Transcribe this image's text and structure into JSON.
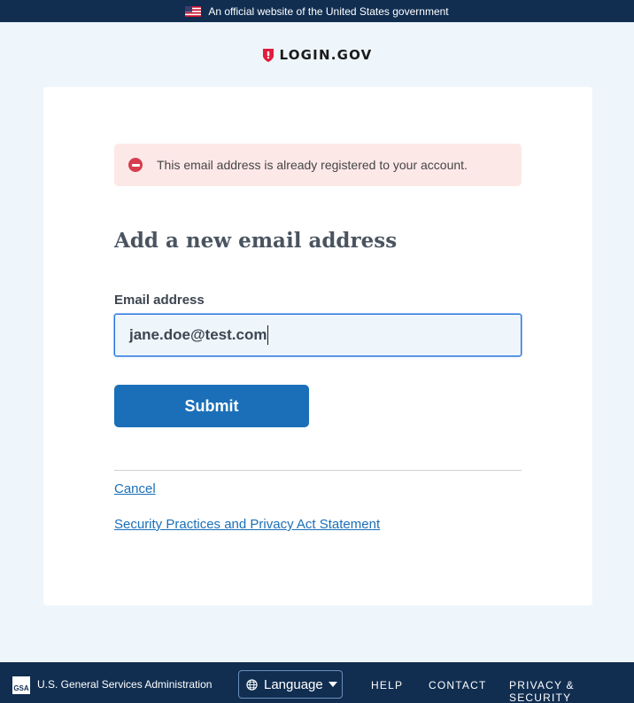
{
  "banner": {
    "text": "An official website of the United States government",
    "flag_icon": "us-flag-icon"
  },
  "logo": {
    "icon": "shield-icon",
    "text": "LOGIN.GOV"
  },
  "alert": {
    "icon": "error-icon",
    "message": "This email address is already registered to your account.",
    "color": "#d63e4f"
  },
  "form": {
    "heading": "Add a new email address",
    "email_label": "Email address",
    "email_value": "jane.doe@test.com",
    "submit_label": "Submit"
  },
  "links": {
    "cancel": "Cancel",
    "privacy": "Security Practices and Privacy Act Statement"
  },
  "footer": {
    "gsa_logo_text": "GSA",
    "gsa_text": "U.S. General Services Administration",
    "language_label": "Language",
    "help": "HELP",
    "contact": "CONTACT",
    "privacy_security": "PRIVACY & SECURITY"
  },
  "colors": {
    "primary": "#1a6fb8",
    "banner_bg": "#112e51",
    "page_bg": "#eef6fb",
    "alert_bg": "#fde8e8"
  }
}
